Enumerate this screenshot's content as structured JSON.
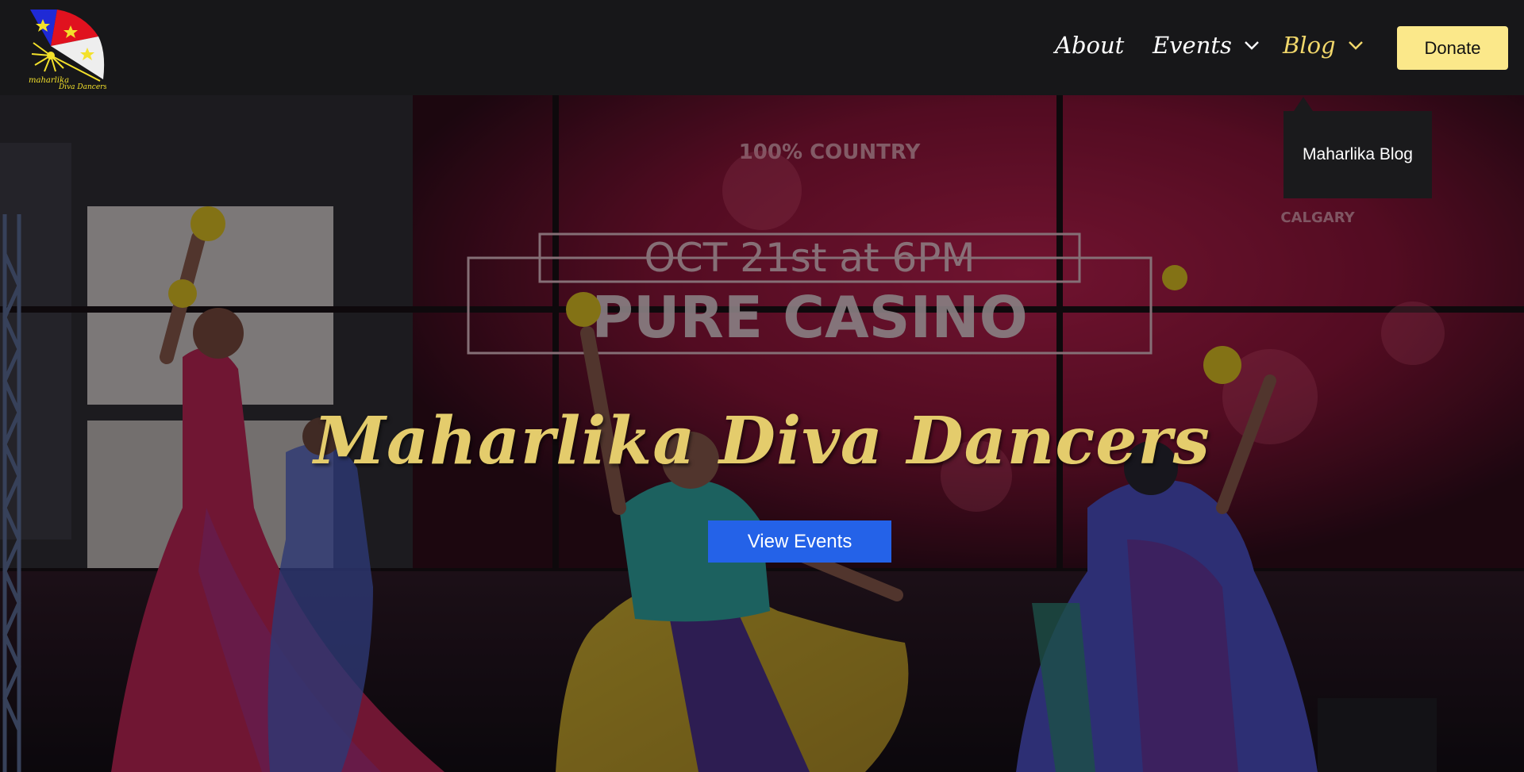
{
  "header": {
    "logo_text_line1": "maharlika",
    "logo_text_line2": "Diva Dancers",
    "nav": {
      "about_label": "About",
      "events_label": "Events",
      "blog_label": "Blog",
      "donate_label": "Donate"
    },
    "blog_dropdown": {
      "items": [
        "Maharlika Blog"
      ]
    }
  },
  "hero": {
    "title": "Maharlika Diva Dancers",
    "cta_label": "View Events",
    "background_image": "photo of dancers in colorful dresses performing on stage in front of a red casino screen",
    "screen_text": {
      "line1": "100% COUNTRY",
      "line2": "OCT 21st at 6PM",
      "line3": "PURE CASINO",
      "side_text": "CALGARY"
    }
  },
  "colors": {
    "header_bg": "#171719",
    "accent_yellow": "#fbe88a",
    "title_gold": "#e4cc6c",
    "cta_blue": "#2462e8",
    "active_nav": "#f2d86b"
  },
  "icons": {
    "events_chevron": "chevron-down-icon",
    "blog_chevron": "chevron-down-icon",
    "logo": "fan-logo-icon"
  }
}
